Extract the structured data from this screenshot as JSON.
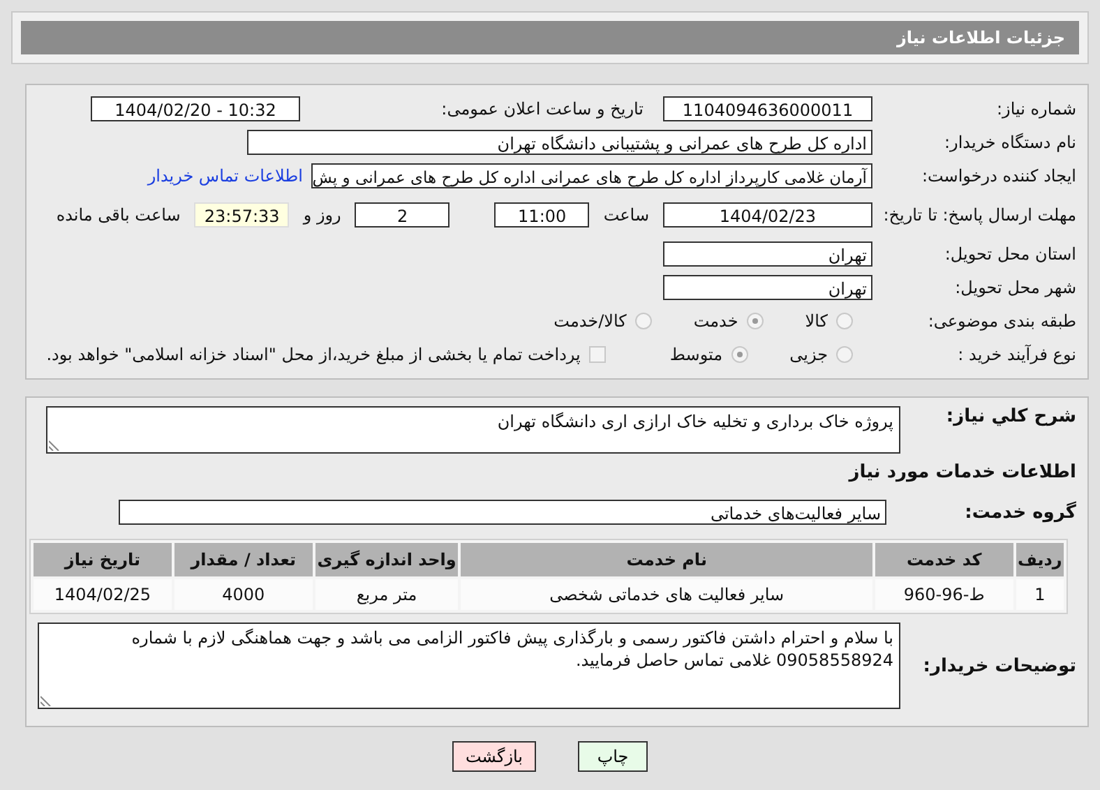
{
  "header": {
    "title": "جزئیات اطلاعات نیاز"
  },
  "need_number": {
    "label": "شماره نیاز:",
    "value": "1104094636000011"
  },
  "announce": {
    "label": "تاریخ و ساعت اعلان عمومی:",
    "value": "1404/02/20 - 10:32"
  },
  "buyer_org": {
    "label": "نام دستگاه خریدار:",
    "value": "اداره کل طرح های عمرانی و پشتیبانی دانشگاه تهران"
  },
  "requester": {
    "label": "ایجاد کننده درخواست:",
    "value": "آرمان غلامی کارپرداز اداره کل طرح های عمرانی اداره کل طرح های عمرانی و پش",
    "link": "اطلاعات تماس خریدار"
  },
  "deadline": {
    "label": "مهلت ارسال پاسخ: تا تاریخ:",
    "date": "1404/02/23",
    "time_label": "ساعت",
    "time": "11:00",
    "days": "2",
    "days_label": "روز و",
    "remaining": "23:57:33",
    "remaining_label": "ساعت باقی مانده"
  },
  "province": {
    "label": "استان محل تحویل:",
    "value": "تهران"
  },
  "city": {
    "label": "شهر محل تحویل:",
    "value": "تهران"
  },
  "category": {
    "label": "طبقه بندی موضوعی:",
    "options": [
      {
        "label": "کالا",
        "selected": false
      },
      {
        "label": "خدمت",
        "selected": true
      },
      {
        "label": "کالا/خدمت",
        "selected": false
      }
    ]
  },
  "process": {
    "label": "نوع فرآیند خرید :",
    "options": [
      {
        "label": "جزیی",
        "selected": false
      },
      {
        "label": "متوسط",
        "selected": true
      }
    ],
    "payment": {
      "label": "پرداخت تمام یا بخشی از مبلغ خرید،از محل \"اسناد خزانه اسلامی\" خواهد بود.",
      "checked": false
    }
  },
  "summary": {
    "label": "شرح کلي نياز:",
    "value": "پروژه خاک برداری و تخلیه خاک ارازی اری دانشگاه تهران"
  },
  "services_heading": "اطلاعات خدمات مورد نیاز",
  "service_group": {
    "label": "گروه خدمت:",
    "value": "سایر فعالیت‌های خدماتی"
  },
  "table": {
    "columns": [
      "ردیف",
      "کد خدمت",
      "نام خدمت",
      "واحد اندازه گیری",
      "تعداد / مقدار",
      "تاریخ نیاز"
    ],
    "rows": [
      [
        "1",
        "ط-96-960",
        "سایر فعالیت های خدماتی شخصی",
        "متر مربع",
        "4000",
        "1404/02/25"
      ]
    ]
  },
  "buyer_notes": {
    "label": "توضیحات خریدار:",
    "value": "با سلام و احترام  داشتن فاکتور رسمی و بارگذاری پیش فاکتور الزامی می باشد و جهت هماهنگی لازم با شماره 09058558924 غلامی تماس حاصل فرمایید."
  },
  "buttons": [
    {
      "label": "چاپ",
      "kind": "print"
    },
    {
      "label": "بازگشت",
      "kind": "back"
    }
  ]
}
